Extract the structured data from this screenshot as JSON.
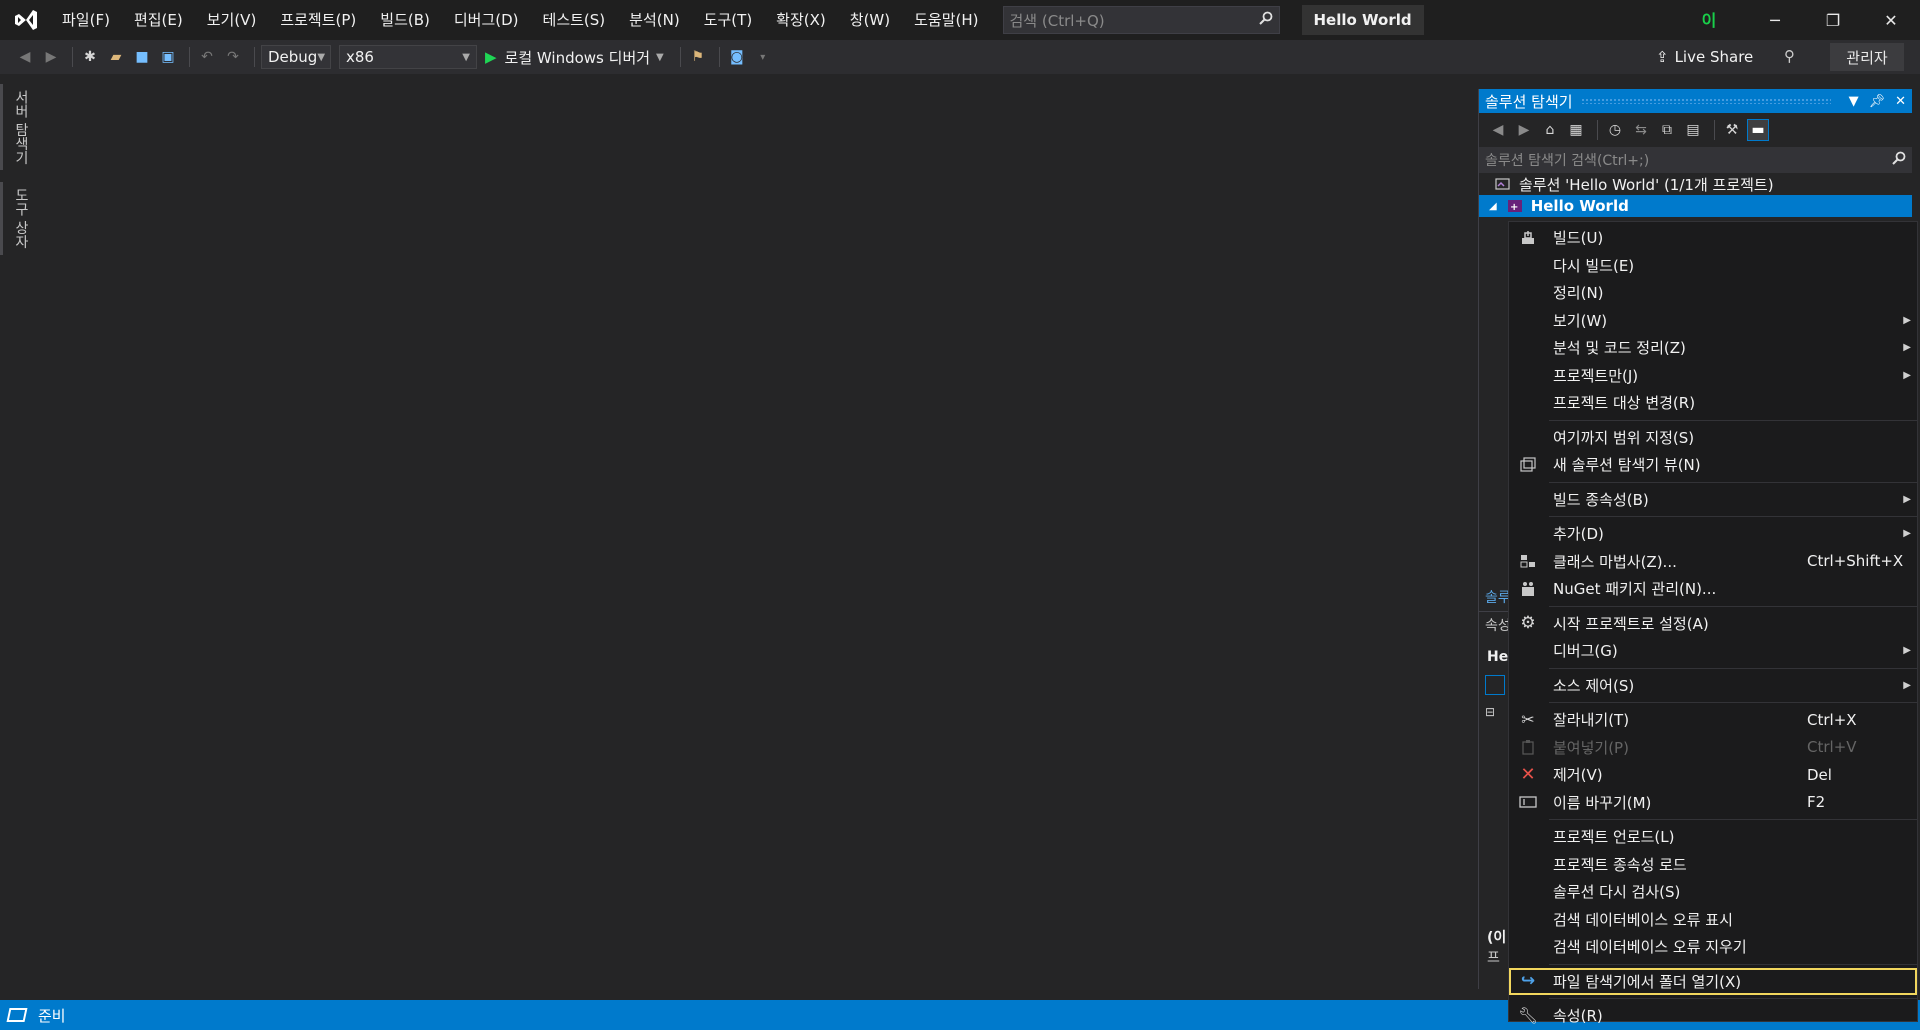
{
  "menu": [
    "파일(F)",
    "편집(E)",
    "보기(V)",
    "프로젝트(P)",
    "빌드(B)",
    "디버그(D)",
    "테스트(S)",
    "분석(N)",
    "도구(T)",
    "확장(X)",
    "창(W)",
    "도움말(H)"
  ],
  "search": {
    "placeholder": "검색 (Ctrl+Q)"
  },
  "solution_name": "Hello World",
  "account_initial": "이",
  "toolbar": {
    "config": "Debug",
    "platform": "x86",
    "run_label": "로컬 Windows 디버거",
    "live_share": "Live Share",
    "admin": "관리자"
  },
  "side_tabs": [
    "서버 탐색기",
    "도구 상자"
  ],
  "explorer": {
    "title": "솔루션 탐색기",
    "search_placeholder": "솔루션 탐색기 검색(Ctrl+;)",
    "solution_row": "솔루션 'Hello World' (1/1개 프로젝트)",
    "project_row": "Hello World",
    "frag_a": "솔루",
    "frag_b": "속성",
    "frag_c": "He",
    "frag_d": "(이",
    "frag_e": "프"
  },
  "context_menu": [
    {
      "label": "빌드(U)",
      "icon": "build-icon"
    },
    {
      "label": "다시 빌드(E)"
    },
    {
      "label": "정리(N)"
    },
    {
      "label": "보기(W)",
      "submenu": true
    },
    {
      "label": "분석 및 코드 정리(Z)",
      "submenu": true
    },
    {
      "label": "프로젝트만(J)",
      "submenu": true
    },
    {
      "label": "프로젝트 대상 변경(R)",
      "sep_after": true
    },
    {
      "label": "여기까지 범위 지정(S)"
    },
    {
      "label": "새 솔루션 탐색기 뷰(N)",
      "icon": "new-view-icon",
      "sep_after": true
    },
    {
      "label": "빌드 종속성(B)",
      "submenu": true,
      "sep_after": true
    },
    {
      "label": "추가(D)",
      "submenu": true
    },
    {
      "label": "클래스 마법사(Z)...",
      "shortcut": "Ctrl+Shift+X",
      "icon": "class-wizard-icon"
    },
    {
      "label": "NuGet 패키지 관리(N)...",
      "icon": "nuget-icon",
      "sep_after": true
    },
    {
      "label": "시작 프로젝트로 설정(A)",
      "icon": "gear-icon"
    },
    {
      "label": "디버그(G)",
      "submenu": true,
      "sep_after": true
    },
    {
      "label": "소스 제어(S)",
      "submenu": true,
      "sep_after": true
    },
    {
      "label": "잘라내기(T)",
      "shortcut": "Ctrl+X",
      "icon": "scissors-icon"
    },
    {
      "label": "붙여넣기(P)",
      "shortcut": "Ctrl+V",
      "icon": "paste-icon",
      "disabled": true
    },
    {
      "label": "제거(V)",
      "shortcut": "Del",
      "icon": "delete-icon"
    },
    {
      "label": "이름 바꾸기(M)",
      "shortcut": "F2",
      "icon": "rename-icon",
      "sep_after": true
    },
    {
      "label": "프로젝트 언로드(L)"
    },
    {
      "label": "프로젝트 종속성 로드"
    },
    {
      "label": "솔루션 다시 검사(S)"
    },
    {
      "label": "검색 데이터베이스 오류 표시"
    },
    {
      "label": "검색 데이터베이스 오류 지우기",
      "sep_after": true
    },
    {
      "label": "파일 탐색기에서 폴더 열기(X)",
      "icon": "open-folder-icon",
      "highlighted": true,
      "sep_after": true
    },
    {
      "label": "속성(R)",
      "icon": "wrench-icon"
    }
  ],
  "status": {
    "text": "준비"
  },
  "colors": {
    "accent": "#007acc",
    "highlight": "#f2d75e",
    "delete": "#e8524a"
  }
}
